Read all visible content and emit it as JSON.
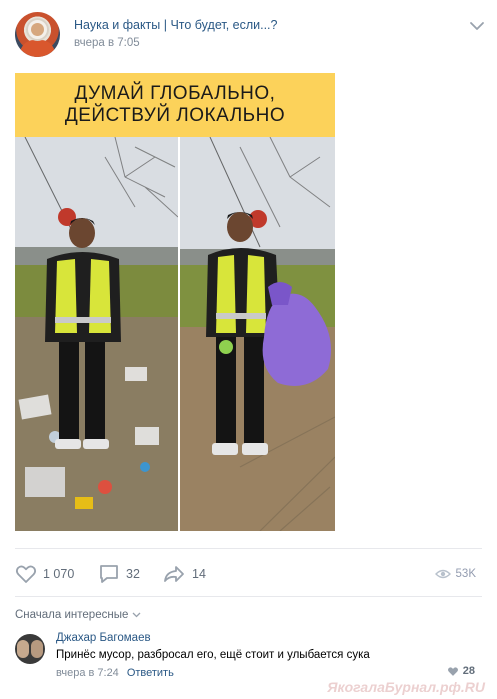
{
  "post": {
    "group_name": "Наука и факты | Что будет, если...?",
    "time": "вчера в 7:05",
    "image_caption_line1": "ДУМАЙ ГЛОБАЛЬНО,",
    "image_caption_line2": "ДЕЙСТВУЙ ЛОКАЛЬНО"
  },
  "actions": {
    "likes": "1 070",
    "comments": "32",
    "shares": "14",
    "views": "53K"
  },
  "comments_section": {
    "sort_label": "Сначала интересные"
  },
  "comment": {
    "author": "Джахар Багомаев",
    "text": "Принёс мусор, разбросал его, ещё стоит и улыбается сука",
    "time": "вчера в 7:24",
    "reply_label": "Ответить",
    "likes": "28"
  },
  "watermark": "ЯкогалаБурнал.рф.RU",
  "colors": {
    "link": "#2a5885",
    "muted": "#818c99",
    "banner": "#fcd25a",
    "vest": "#d8e53a"
  },
  "icons": [
    "chevron-down-icon",
    "heart-icon",
    "comment-icon",
    "share-icon",
    "eye-icon"
  ]
}
